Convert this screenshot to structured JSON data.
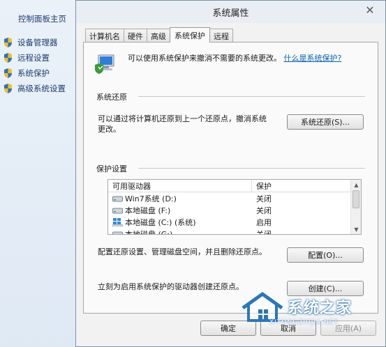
{
  "left_panel": {
    "home": "控制面板主页",
    "items": [
      {
        "label": "设备管理器",
        "icon": "shield-icon"
      },
      {
        "label": "远程设置",
        "icon": "shield-icon"
      },
      {
        "label": "系统保护",
        "icon": "shield-icon"
      },
      {
        "label": "高级系统设置",
        "icon": "shield-icon"
      }
    ]
  },
  "dialog": {
    "title": "系统属性",
    "close_glyph": "✕",
    "tabs": [
      "计算机名",
      "硬件",
      "高级",
      "系统保护",
      "远程"
    ],
    "active_tab": "系统保护",
    "intro": {
      "text": "可以使用系统保护来撤消不需要的系统更改。",
      "link": "什么是系统保护?"
    },
    "restore": {
      "group": "系统还原",
      "text_line1": "可以通过将计算机还原到上一个还原点，撤消系统",
      "text_line2": "更改。",
      "button": "系统还原(S)..."
    },
    "protection": {
      "group": "保护设置",
      "columns": [
        "可用驱动器",
        "保护"
      ],
      "rows": [
        {
          "drive": "Win7系统 (D:)",
          "status": "关闭",
          "icon": "drive-icon"
        },
        {
          "drive": "本地磁盘 (F:)",
          "status": "关闭",
          "icon": "drive-icon"
        },
        {
          "drive": "本地磁盘 (C:) (系统)",
          "status": "启用",
          "icon": "windows-drive-icon"
        },
        {
          "drive": "本地磁盘 (G:)",
          "status": "关闭",
          "icon": "drive-icon"
        }
      ],
      "config_text": "配置还原设置、管理磁盘空间，并且删除还原点。",
      "config_button": "配置(O)...",
      "create_text": "立刻为启用系统保护的驱动器创建还原点。",
      "create_button": "创建(C)..."
    },
    "footer": {
      "ok": "确定",
      "cancel": "取消",
      "apply": "应用(A)"
    }
  },
  "watermark": {
    "title": "系统之家",
    "subtitle": "XITONGZHIJIA.NET"
  },
  "colors": {
    "link": "#0b5fb8",
    "left_text": "#1e3c6e",
    "watermark": "#2c76b8"
  }
}
